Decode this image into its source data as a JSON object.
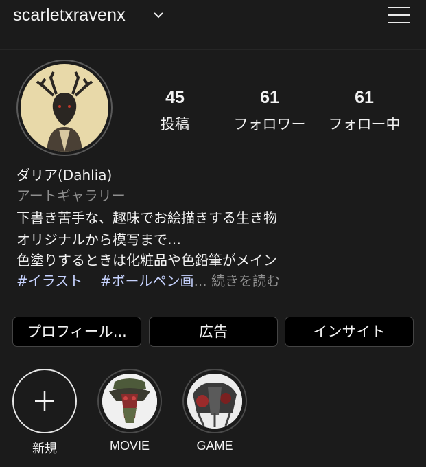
{
  "header": {
    "username": "scarletxravenx",
    "dropdown_icon": "chevron-down-icon",
    "menu_icon": "hamburger-menu-icon"
  },
  "stats": [
    {
      "value": "45",
      "label": "投稿"
    },
    {
      "value": "61",
      "label": "フォロワー"
    },
    {
      "value": "61",
      "label": "フォロー中"
    }
  ],
  "bio": {
    "name": "ダリア(Dahlia)",
    "category": "アートギャラリー",
    "line1": "下書き苦手な、趣味でお絵描きする生き物",
    "line2": "オリジナルから模写まで…",
    "line3": "色塗りするときは化粧品や色鉛筆がメイン",
    "hashtag1": "#イラスト",
    "hashtag2": "#ボールペン画",
    "ellipsis": "...",
    "more": "続きを読む"
  },
  "buttons": {
    "profile": "プロフィール...",
    "ads": "広告",
    "insights": "インサイト"
  },
  "highlights": [
    {
      "label": "新規"
    },
    {
      "label": "MOVIE"
    },
    {
      "label": "GAME"
    }
  ],
  "colors": {
    "background": "#1b1b1b",
    "text": "#f2f2f2",
    "secondary_text": "#8f8f8f",
    "hashtag": "#c7d3ff",
    "button_bg": "#000000"
  }
}
